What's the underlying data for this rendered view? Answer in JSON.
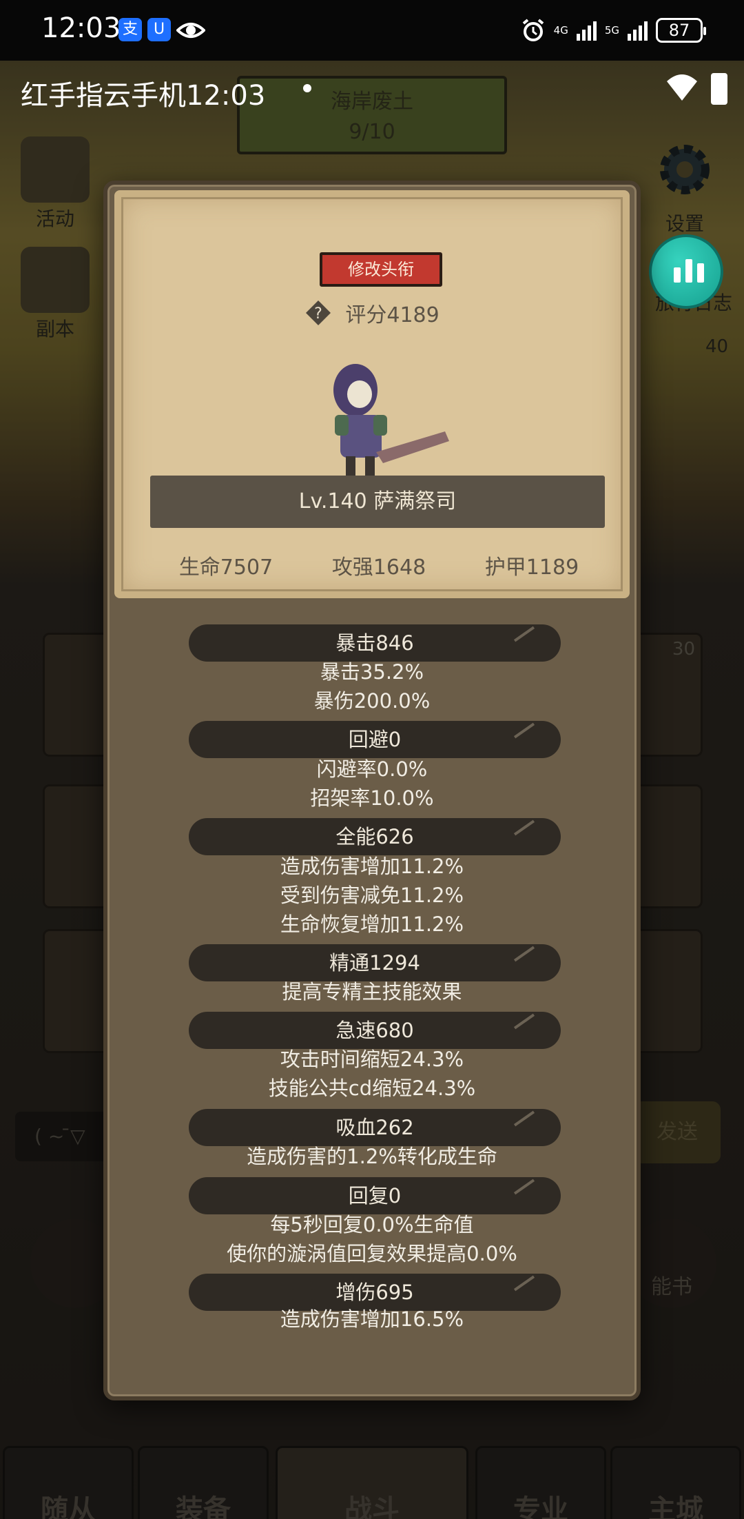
{
  "status_bar": {
    "time": "12:03",
    "app_icon_1": "支",
    "app_icon_2": "U",
    "network_top": "4G",
    "network_bottom": "5G",
    "battery": "87"
  },
  "overlay": {
    "title": "红手指云手机12:03"
  },
  "background": {
    "banner_title": "海岸废土",
    "banner_progress": "9/10",
    "left_menu": [
      "活动",
      "副本"
    ],
    "right_menu": [
      "设置",
      "旅行日志"
    ],
    "right_level": "40",
    "tile_badge": "30",
    "send_label": "发送",
    "chat_text": "( ~ ̄▽",
    "skill_book": "能书",
    "bottom_tabs": [
      "随从",
      "装备",
      "战斗",
      "专业",
      "主城"
    ]
  },
  "card": {
    "edit_title_button": "修改头衔",
    "score": "评分4189",
    "name": "Lv.140 萨满祭司",
    "attributes": [
      "生命7507",
      "攻强1648",
      "护甲1189"
    ]
  },
  "stats": [
    {
      "header": "暴击846",
      "lines": [
        "暴击35.2%",
        "暴伤200.0%"
      ]
    },
    {
      "header": "回避0",
      "lines": [
        "闪避率0.0%",
        "招架率10.0%"
      ]
    },
    {
      "header": "全能626",
      "lines": [
        "造成伤害增加11.2%",
        "受到伤害减免11.2%",
        "生命恢复增加11.2%"
      ]
    },
    {
      "header": "精通1294",
      "lines": [
        "提高专精主技能效果"
      ]
    },
    {
      "header": "急速680",
      "lines": [
        "攻击时间缩短24.3%",
        "技能公共cd缩短24.3%"
      ]
    },
    {
      "header": "吸血262",
      "lines": [
        "造成伤害的1.2%转化成生命"
      ]
    },
    {
      "header": "回复0",
      "lines": [
        "每5秒回复0.0%生命值",
        "使你的漩涡值回复效果提高0.0%"
      ]
    },
    {
      "header": "增伤695",
      "lines": [
        "造成伤害增加16.5%"
      ]
    }
  ],
  "colors": {
    "accent_button": "#c2392f",
    "panel": "#6b5d48",
    "card": "#dbc59b",
    "stat_header": "#2f2a24"
  },
  "icons": [
    "eye-icon",
    "alarm-icon",
    "signal-icon",
    "wifi-icon",
    "battery-icon",
    "help-icon",
    "stats-chart-icon",
    "gear-icon"
  ]
}
